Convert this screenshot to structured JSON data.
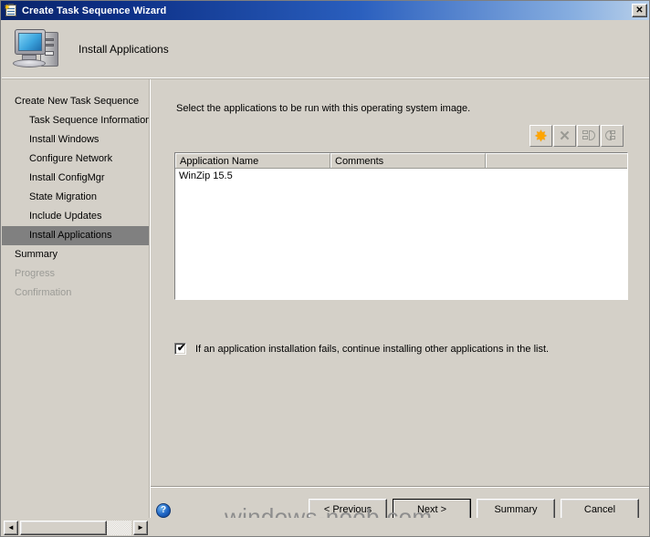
{
  "window": {
    "title": "Create Task Sequence Wizard",
    "icon": "task-sequence-icon",
    "close_label": "✕"
  },
  "header": {
    "title": "Install Applications",
    "icon": "computer-icon"
  },
  "sidebar": {
    "items": [
      {
        "label": "Create New Task Sequence",
        "level": 0,
        "state": "normal"
      },
      {
        "label": "Task Sequence Information",
        "level": 1,
        "state": "normal"
      },
      {
        "label": "Install Windows",
        "level": 1,
        "state": "normal"
      },
      {
        "label": "Configure Network",
        "level": 1,
        "state": "normal"
      },
      {
        "label": "Install ConfigMgr",
        "level": 1,
        "state": "normal"
      },
      {
        "label": "State Migration",
        "level": 1,
        "state": "normal"
      },
      {
        "label": "Include Updates",
        "level": 1,
        "state": "normal"
      },
      {
        "label": "Install Applications",
        "level": 1,
        "state": "selected"
      },
      {
        "label": "Summary",
        "level": 0,
        "state": "normal"
      },
      {
        "label": "Progress",
        "level": 0,
        "state": "disabled"
      },
      {
        "label": "Confirmation",
        "level": 0,
        "state": "disabled"
      }
    ],
    "selected_color": "#808080",
    "disabled_color": "#9b9b96"
  },
  "main": {
    "instruction": "Select the applications to be run with this operating system image.",
    "toolbar": [
      {
        "name": "new-application-button",
        "icon": "starburst-icon",
        "glyph": "✸",
        "state": "hot"
      },
      {
        "name": "delete-application-button",
        "icon": "x-delete-icon",
        "glyph": "✕",
        "state": "raised"
      },
      {
        "name": "move-up-button",
        "icon": "move-up-icon",
        "glyph": "",
        "state": "raised"
      },
      {
        "name": "move-down-button",
        "icon": "move-down-icon",
        "glyph": "",
        "state": "raised"
      }
    ],
    "list": {
      "columns": [
        "Application Name",
        "Comments",
        ""
      ],
      "rows": [
        {
          "application_name": "WinZip 15.5",
          "comments": "",
          "extra": ""
        }
      ]
    },
    "checkbox": {
      "checked": true,
      "tick": "✔",
      "label": "If an application installation fails, continue installing other applications in the list."
    }
  },
  "footer": {
    "help_glyph": "?",
    "buttons": [
      {
        "label": "< Previous",
        "name": "previous-button",
        "default": false
      },
      {
        "label": "Next >",
        "name": "next-button",
        "default": true
      },
      {
        "label": "Summary",
        "name": "summary-button",
        "default": false
      },
      {
        "label": "Cancel",
        "name": "cancel-button",
        "default": false
      }
    ]
  },
  "watermark": {
    "text": "windows-noob.com"
  },
  "scrollbar": {
    "left_arrow": "◄",
    "right_arrow": "►"
  }
}
